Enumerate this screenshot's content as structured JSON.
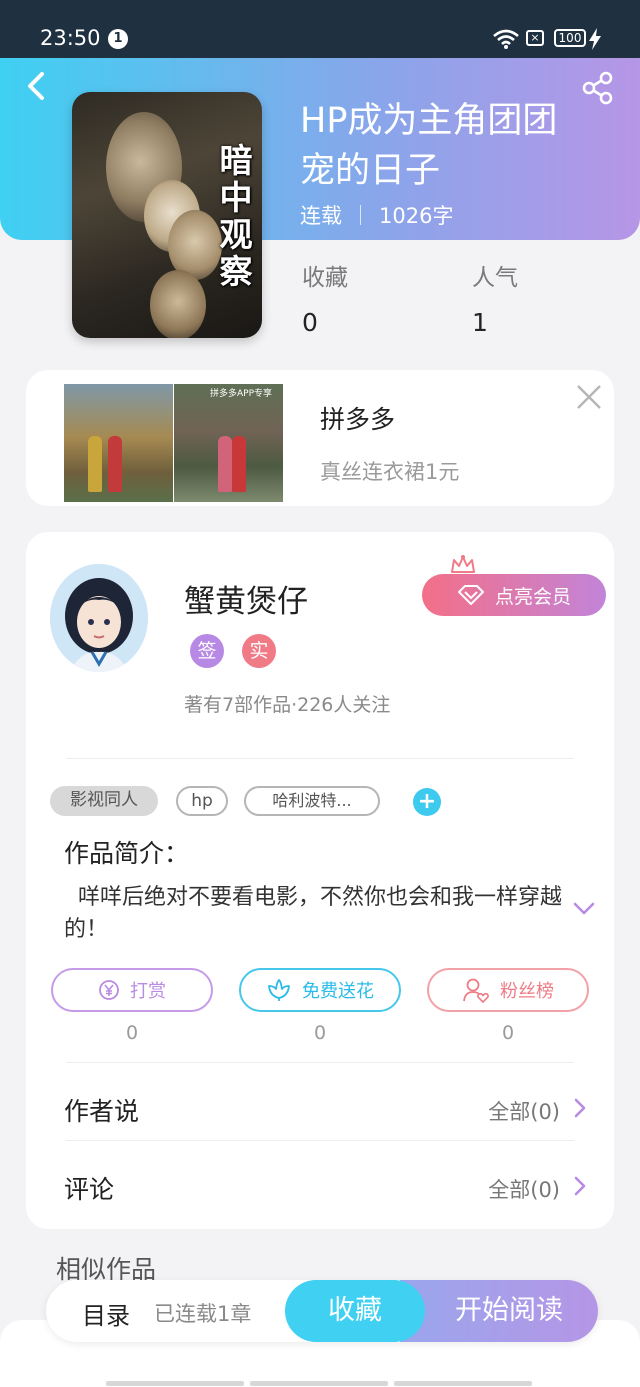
{
  "status_bar": {
    "time": "23:50",
    "notification_count": "1",
    "battery": "100",
    "sim_icon": "sim-x-icon"
  },
  "header": {
    "book_title": "HP成为主角团团宠的日子",
    "status": "连载",
    "word_count": "1026字",
    "cover_caption": "暗中观察",
    "colors": {
      "gradient_start": "#3fd0f2",
      "gradient_end": "#b696e6"
    }
  },
  "stats": {
    "favorites_label": "收藏",
    "favorites_value": "0",
    "popularity_label": "人气",
    "popularity_value": "1"
  },
  "ad": {
    "title": "拼多多",
    "subtitle": "真丝连衣裙1元",
    "img2_tag": "拼多多APP专享"
  },
  "author": {
    "name": "蟹黄煲仔",
    "badge_sign": "签",
    "badge_real": "实",
    "stats": "著有7部作品·226人关注",
    "vip_button": "点亮会员"
  },
  "tags": {
    "category": "影视同人",
    "tag1": "hp",
    "tag2": "哈利波特...",
    "add": "+"
  },
  "intro": {
    "title": "作品简介：",
    "text": "咩咩后绝对不要看电影，不然你也会和我一样穿越的！"
  },
  "actions": {
    "reward_label": "打赏",
    "reward_count": "0",
    "flower_label": "免费送花",
    "flower_count": "0",
    "fans_label": "粉丝榜",
    "fans_count": "0"
  },
  "rows": {
    "author_says": "作者说",
    "author_says_more": "全部(0)",
    "comments": "评论",
    "comments_more": "全部(0)"
  },
  "similar_title": "相似作品",
  "bottom": {
    "toc": "目录",
    "chapters": "已连载1章",
    "favorite": "收藏",
    "start_reading": "开始阅读"
  }
}
